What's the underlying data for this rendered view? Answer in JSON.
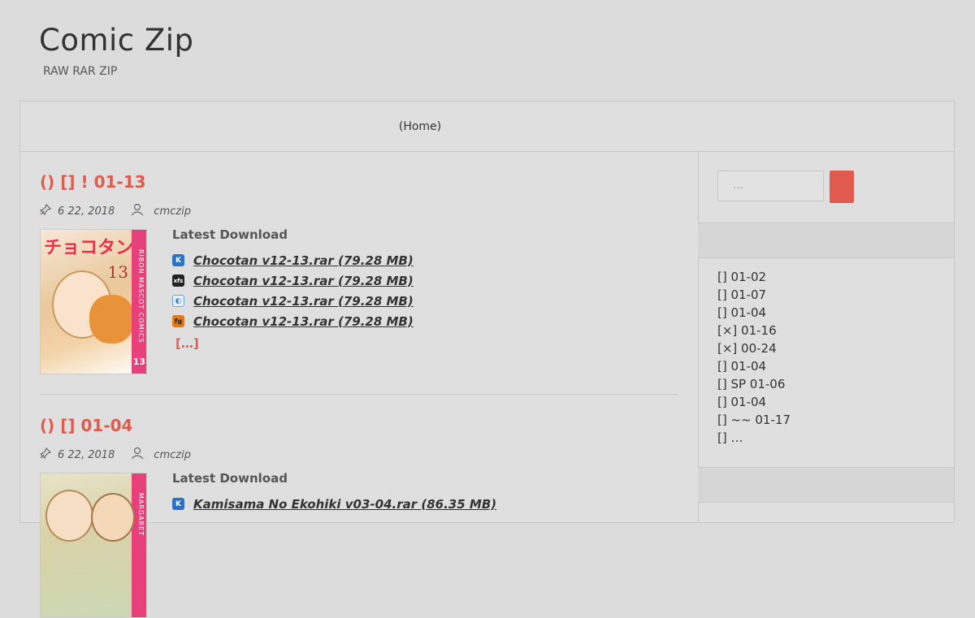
{
  "site": {
    "title": "Comic Zip",
    "description": "RAW RAR ZIP"
  },
  "nav": {
    "home_label": "(Home)"
  },
  "posts": [
    {
      "title": "() [] ! 01-13",
      "date": "6 22, 2018",
      "author": "cmczip",
      "cover_number": "13",
      "download_heading": "Latest Download",
      "downloads": [
        {
          "icon": "katfile-icon",
          "label": "Chocotan v12-13.rar (79.28 MB)"
        },
        {
          "icon": "xfs-icon",
          "label": "Chocotan v12-13.rar (79.28 MB)"
        },
        {
          "icon": "cloud-icon",
          "label": "Chocotan v12-13.rar (79.28 MB)"
        },
        {
          "icon": "fg-icon",
          "label": "Chocotan v12-13.rar (79.28 MB)"
        }
      ],
      "more": "[…]"
    },
    {
      "title": "() []  01-04",
      "date": "6 22, 2018",
      "author": "cmczip",
      "download_heading": "Latest Download",
      "downloads": [
        {
          "icon": "katfile-icon",
          "label": "Kamisama No Ekohiki v03-04.rar (86.35 MB)"
        }
      ]
    }
  ],
  "sidebar": {
    "search_placeholder": "…",
    "recent": [
      "[]  01-02",
      "[]  01-07",
      "[]  01-04",
      "[×]  01-16",
      "[×]  00-24",
      "[]  01-04",
      "[] SP 01-06",
      "[]  01-04",
      "[]  ~~ 01-17",
      "[] …"
    ]
  },
  "colors": {
    "accent": "#e05a4e",
    "background": "#dcdcdc"
  }
}
